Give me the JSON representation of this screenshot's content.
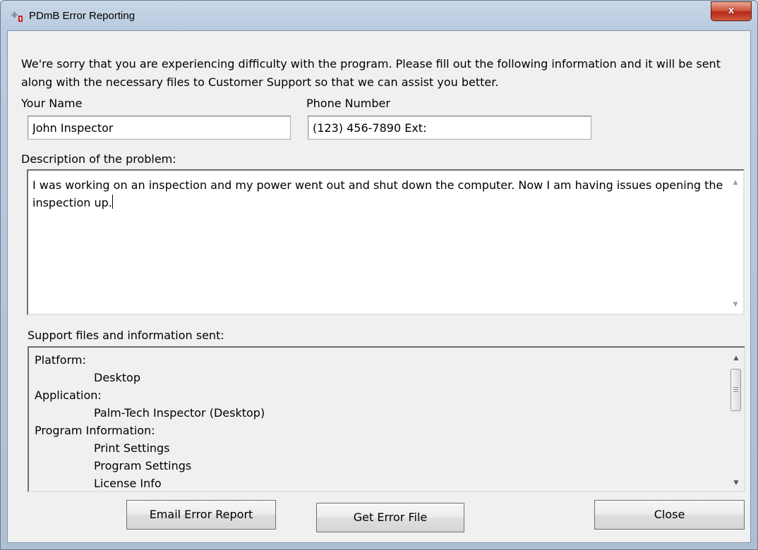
{
  "window": {
    "title": "PDmB Error Reporting",
    "close_glyph": "x"
  },
  "intro": "We're sorry that you are experiencing difficulty with the program. Please fill out the following information and it will be sent along with the necessary files to Customer Support so that we can assist you better.",
  "form": {
    "name_label": "Your Name",
    "name_value": "John Inspector",
    "phone_label": "Phone Number",
    "phone_value": "(123) 456-7890 Ext:",
    "description_label": "Description of the problem:",
    "description_value": "I was working on an inspection and my power went out and shut down the computer. Now I am having issues opening the inspection up."
  },
  "support": {
    "label": "Support files and information sent:",
    "lines": [
      {
        "text": "Platform:",
        "indent": false
      },
      {
        "text": "Desktop",
        "indent": true
      },
      {
        "text": "Application:",
        "indent": false
      },
      {
        "text": "Palm-Tech Inspector (Desktop)",
        "indent": true
      },
      {
        "text": "Program Information:",
        "indent": false
      },
      {
        "text": "Print Settings",
        "indent": true
      },
      {
        "text": "Program Settings",
        "indent": true
      },
      {
        "text": "License Info",
        "indent": true
      }
    ]
  },
  "buttons": {
    "email": "Email Error Report",
    "get_file": "Get Error File",
    "close": "Close"
  },
  "colors": {
    "close_button": "#c4402c",
    "panel": "#f0f0f0",
    "frame": "#b9cbe0"
  }
}
